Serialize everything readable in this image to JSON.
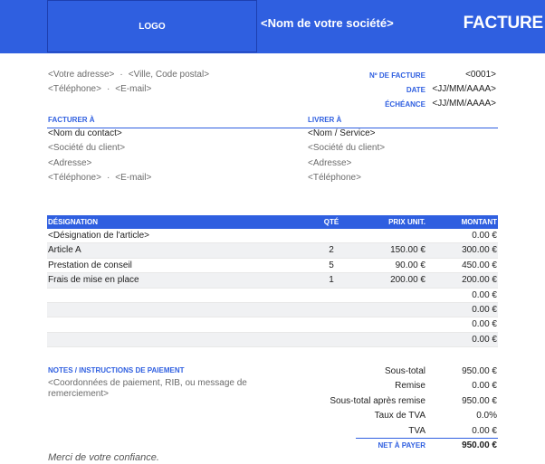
{
  "header": {
    "logo": "LOGO",
    "company": "<Nom de votre société>",
    "title": "FACTURE"
  },
  "sender": {
    "address": "<Votre adresse>",
    "city": "<Ville, Code postal>",
    "phone": "<Téléphone>",
    "email": "<E-mail>",
    "separator": "·"
  },
  "invoice_meta": {
    "number_label": "Nº DE FACTURE",
    "number_value": "<0001>",
    "date_label": "DATE",
    "date_value": "<JJ/MM/AAAA>",
    "due_label": "ÉCHÉANCE",
    "due_value": "<JJ/MM/AAAA>"
  },
  "bill_to": {
    "heading": "FACTURER À",
    "contact": "<Nom du contact>",
    "company": "<Société du client>",
    "address": "<Adresse>",
    "phone": "<Téléphone>",
    "email": "<E-mail>"
  },
  "ship_to": {
    "heading": "LIVRER À",
    "name": "<Nom / Service>",
    "company": "<Société du client>",
    "address": "<Adresse>",
    "phone": "<Téléphone>"
  },
  "items": {
    "headers": {
      "desc": "DÉSIGNATION",
      "qty": "QTÉ",
      "price": "PRIX UNIT.",
      "amount": "MONTANT"
    },
    "rows": [
      {
        "desc": "<Désignation de l'article>",
        "qty": "",
        "price": "",
        "amount": "0.00 €"
      },
      {
        "desc": "Article A",
        "qty": "2",
        "price": "150.00 €",
        "amount": "300.00 €"
      },
      {
        "desc": "Prestation de conseil",
        "qty": "5",
        "price": "90.00 €",
        "amount": "450.00 €"
      },
      {
        "desc": "Frais de mise en place",
        "qty": "1",
        "price": "200.00 €",
        "amount": "200.00 €"
      },
      {
        "desc": "",
        "qty": "",
        "price": "",
        "amount": "0.00 €"
      },
      {
        "desc": "",
        "qty": "",
        "price": "",
        "amount": "0.00 €"
      },
      {
        "desc": "",
        "qty": "",
        "price": "",
        "amount": "0.00 €"
      },
      {
        "desc": "",
        "qty": "",
        "price": "",
        "amount": "0.00 €"
      }
    ]
  },
  "notes": {
    "heading": "NOTES / INSTRUCTIONS DE PAIEMENT",
    "line1": "<Coordonnées de paiement, RIB, ou message de",
    "line2": "remerciement>"
  },
  "totals": [
    {
      "label": "Sous-total",
      "value": "950.00 €"
    },
    {
      "label": "Remise",
      "value": "0.00 €"
    },
    {
      "label": "Sous-total après remise",
      "value": "950.00 €"
    },
    {
      "label": "Taux de TVA",
      "value": "0.0%"
    },
    {
      "label": "TVA",
      "value": "0.00 €"
    },
    {
      "label": "NET À PAYER",
      "value": "950.00 €"
    }
  ],
  "footer": {
    "thanks": "Merci de votre confiance."
  },
  "colors": {
    "accent": "#2f5fe0",
    "row_alt": "#f0f1f3"
  }
}
